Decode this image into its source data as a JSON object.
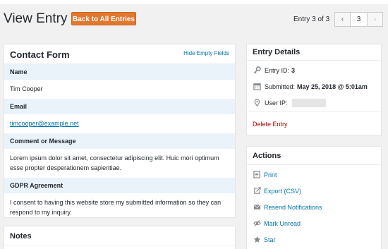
{
  "header": {
    "title": "View Entry",
    "back_button": "Back to All Entries",
    "entry_count": "Entry 3 of 3",
    "pager": {
      "prev": "‹",
      "current": "3",
      "next": "›"
    }
  },
  "contact_form": {
    "title": "Contact Form",
    "hide_empty": "Hide Empty Fields",
    "fields": [
      {
        "label": "Name",
        "value": "Tim Cooper"
      },
      {
        "label": "Email",
        "value": "timcooper@example.net"
      },
      {
        "label": "Comment or Message",
        "value": "Lorem ipsum dolor sit amet, consectetur adipiscing elit. Huic mori optimum esse propter desperationem sapientiae."
      },
      {
        "label": "GDPR Agreement",
        "value": "I consent to having this website store my submitted information so they can respond to my inquiry."
      }
    ]
  },
  "notes": {
    "title": "Notes"
  },
  "entry_details": {
    "title": "Entry Details",
    "entry_id_label": "Entry ID:",
    "entry_id_value": "3",
    "submitted_label": "Submitted:",
    "submitted_value": "May 25, 2018 @ 5:01am",
    "user_ip_label": "User IP:",
    "delete_label": "Delete Entry"
  },
  "actions": {
    "title": "Actions",
    "items": [
      {
        "label": "Print",
        "icon": "print-icon"
      },
      {
        "label": "Export (CSV)",
        "icon": "export-icon"
      },
      {
        "label": "Resend Notifications",
        "icon": "envelope-icon"
      },
      {
        "label": "Mark Unread",
        "icon": "eye-slash-icon"
      },
      {
        "label": "Star",
        "icon": "star-icon"
      }
    ]
  },
  "colors": {
    "accent": "#e27730",
    "link": "#0073aa",
    "delete": "#aa0000",
    "label_bg": "#eaf2fa"
  }
}
